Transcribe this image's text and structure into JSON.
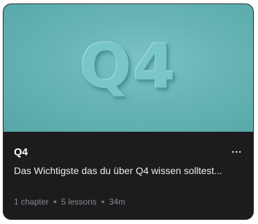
{
  "course": {
    "thumbnail_text": "Q4",
    "title": "Q4",
    "description": "Das Wichtigste das du über Q4 wissen solltest...",
    "chapters": "1 chapter",
    "lessons": "5 lessons",
    "duration": "34m"
  },
  "icons": {
    "more": "more-horizontal-icon"
  },
  "colors": {
    "card_background": "#1c1c1e",
    "thumbnail_teal": "#66b4b6",
    "title_text": "#ffffff",
    "meta_text": "#8a8a8f"
  }
}
